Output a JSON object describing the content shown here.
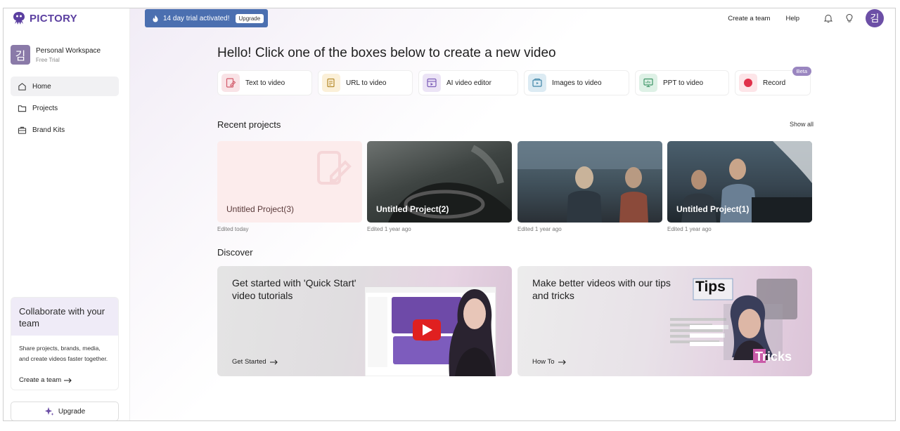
{
  "sidebar": {
    "logo_text": "PICTORY",
    "workspace": {
      "avatar": "김",
      "name": "Personal Workspace",
      "plan": "Free Trial"
    },
    "nav": [
      {
        "label": "Home",
        "icon": "home-icon"
      },
      {
        "label": "Projects",
        "icon": "folder-icon"
      },
      {
        "label": "Brand Kits",
        "icon": "briefcase-icon"
      }
    ],
    "collab": {
      "title": "Collaborate with your team",
      "body": "Share projects, brands, media, and create videos faster together.",
      "link": "Create a team"
    },
    "upgrade_label": "Upgrade"
  },
  "topbar": {
    "trial_text": "14 day trial activated!",
    "trial_button": "Upgrade",
    "create_team": "Create a team",
    "help": "Help",
    "avatar": "김"
  },
  "main": {
    "hello": "Hello! Click one of the boxes below to create a new video",
    "quick_actions": [
      {
        "label": "Text to video",
        "icon": "text-to-video-icon",
        "color": "#f9e3e6"
      },
      {
        "label": "URL to video",
        "icon": "url-to-video-icon",
        "color": "#fbf0d8"
      },
      {
        "label": "AI video editor",
        "icon": "ai-video-editor-icon",
        "color": "#ece4f6"
      },
      {
        "label": "Images to video",
        "icon": "images-to-video-icon",
        "color": "#dcebf3"
      },
      {
        "label": "PPT to video",
        "icon": "ppt-to-video-icon",
        "color": "#def1e6"
      },
      {
        "label": "Record",
        "icon": "record-icon",
        "color": "#fde5e8",
        "badge": "Beta"
      }
    ],
    "recent_title": "Recent projects",
    "show_all": "Show all",
    "projects": [
      {
        "name": "Untitled Project(3)",
        "edited": "Edited today"
      },
      {
        "name": "Untitled Project(2)",
        "edited": "Edited 1 year ago"
      },
      {
        "name": "",
        "edited": "Edited 1 year ago"
      },
      {
        "name": "Untitled Project(1)",
        "edited": "Edited 1 year ago"
      }
    ],
    "discover_title": "Discover",
    "discover": [
      {
        "title": "Get started with 'Quick Start' video tutorials",
        "link": "Get Started"
      },
      {
        "title": "Make better videos with our tips and tricks",
        "link": "How To"
      }
    ],
    "tips_word": "Tips",
    "tricks_word": "Tricks"
  }
}
